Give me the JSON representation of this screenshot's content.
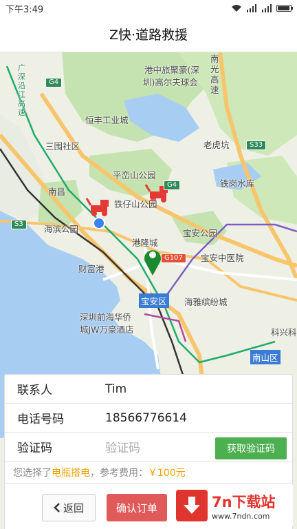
{
  "status": {
    "time": "下午3:49"
  },
  "header": {
    "title": "Z快·道路救援"
  },
  "map": {
    "pois": [
      {
        "id": "poi-1",
        "text": "港中旅聚豪(深"
      },
      {
        "id": "poi-2",
        "text": "圳)高尔夫球会"
      },
      {
        "id": "poi-3",
        "text": "恒丰工业城"
      },
      {
        "id": "poi-4",
        "text": "三围社区"
      },
      {
        "id": "poi-5",
        "text": "老虎坑"
      },
      {
        "id": "poi-6",
        "text": "平峦山公园"
      },
      {
        "id": "poi-7",
        "text": "铁岗水库"
      },
      {
        "id": "poi-8",
        "text": "南昌"
      },
      {
        "id": "poi-9",
        "text": "铁仔山公园"
      },
      {
        "id": "poi-10",
        "text": "海滨公园"
      },
      {
        "id": "poi-11",
        "text": "宝安公园"
      },
      {
        "id": "poi-12",
        "text": "港隆城"
      },
      {
        "id": "poi-13",
        "text": "宝安中医院"
      },
      {
        "id": "poi-14",
        "text": "财富港"
      },
      {
        "id": "poi-15",
        "text": "海雅缤纷城"
      },
      {
        "id": "poi-16",
        "text": "深圳前海华侨"
      },
      {
        "id": "poi-17",
        "text": "城JW万豪酒店"
      },
      {
        "id": "poi-18",
        "text": "科兴科"
      },
      {
        "id": "poi-19",
        "text": "南光高速"
      },
      {
        "id": "poi-20",
        "text": "广深沿江高速"
      }
    ],
    "shields": {
      "g4a": "G4",
      "g4b": "G4",
      "s33": "S33",
      "s3": "S3",
      "g107": "G107"
    },
    "districts": {
      "baoan": "宝安区",
      "nanshan": "南山区"
    }
  },
  "form": {
    "contact_label": "联系人",
    "contact_value": "Tim",
    "phone_label": "电话号码",
    "phone_value": "18566776614",
    "code_label": "验证码",
    "code_placeholder": "验证码",
    "get_code_button": "获取验证码",
    "info_prefix": "您选择了",
    "service": "电瓶搭电",
    "fee_label": "，参考费用：",
    "fee": "￥100元",
    "back_button": "返回",
    "confirm_button": "确认订单"
  },
  "watermark": {
    "main": "7n下载站",
    "sub": "www.7ndn.com"
  },
  "colors": {
    "accent_green": "#4caf50",
    "confirm_red": "#e05a5a",
    "highlight": "#f5a000",
    "district_blue": "#3a7bd5"
  }
}
